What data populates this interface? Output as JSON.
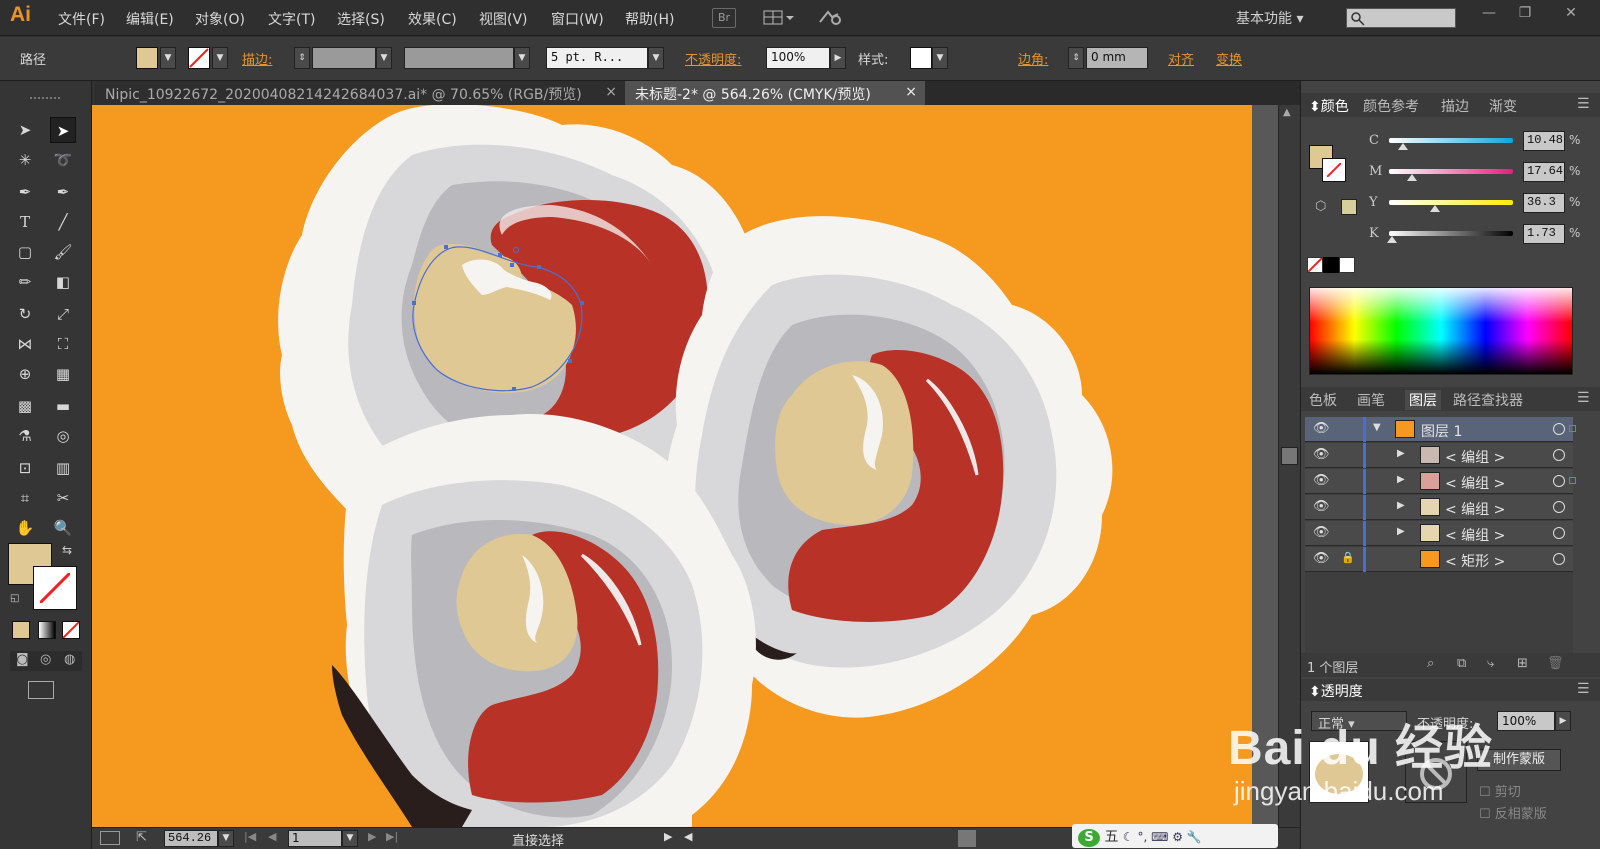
{
  "app": {
    "logo": "Ai",
    "workspace": "基本功能"
  },
  "menu": [
    "文件(F)",
    "编辑(E)",
    "对象(O)",
    "文字(T)",
    "选择(S)",
    "效果(C)",
    "视图(V)",
    "窗口(W)",
    "帮助(H)"
  ],
  "menu_icons": {
    "bridge": "Br",
    "arrange": "arrange-icon",
    "sync": "sync-icon"
  },
  "control": {
    "path_label": "路径",
    "stroke_label": "描边",
    "brush_value": "5 pt. R...",
    "opacity_label": "不透明度",
    "opacity_value": "100%",
    "style_label": "样式",
    "corner_label": "边角",
    "corner_value": "0 mm",
    "align_label": "对齐",
    "transform_label": "变换",
    "fill_color": "#dfc893"
  },
  "tabs": [
    {
      "label": "Nipic_10922672_20200408214242684037.ai* @ 70.65% (RGB/预览)",
      "close": "×"
    },
    {
      "label": "未标题-2* @ 564.26% (CMYK/预览)",
      "close": "×"
    }
  ],
  "status": {
    "zoom": "564.26",
    "page": "1",
    "tool_label": "直接选择"
  },
  "color_panel": {
    "tabs": [
      "颜色",
      "颜色参考",
      "描边",
      "渐变"
    ],
    "channels": [
      {
        "label": "C",
        "value": "10.48",
        "pct": 10.48
      },
      {
        "label": "M",
        "value": "17.64",
        "pct": 17.64
      },
      {
        "label": "Y",
        "value": "36.3",
        "pct": 36.3
      },
      {
        "label": "K",
        "value": "1.73",
        "pct": 1.73
      }
    ],
    "unit": "%"
  },
  "layers_panel": {
    "tabs": [
      "色板",
      "画笔",
      "图层",
      "路径查找器"
    ],
    "rows": [
      {
        "name": "图层 1",
        "top": true
      },
      {
        "name": "< 编组 >"
      },
      {
        "name": "< 编组 >"
      },
      {
        "name": "< 编组 >"
      },
      {
        "name": "< 编组 >"
      },
      {
        "name": "< 矩形 >",
        "locked": true
      }
    ],
    "footer": "1 个图层"
  },
  "transparency_panel": {
    "title": "透明度",
    "blend": "正常",
    "opacity_label": "不透明度",
    "opacity_value": "100%",
    "mask_button": "制作蒙版",
    "clip_label": "剪切",
    "invert_label": "反相蒙版"
  },
  "watermark": {
    "brand": "Bai du 经验",
    "url": "jingyan.baidu.com"
  },
  "ime": {
    "text": "五"
  },
  "colors": {
    "orange": "#f5991f",
    "beige": "#dfc893",
    "red": "#b83228",
    "shell_white": "#f5f4f1",
    "shell_gray": "#d8d8da",
    "inner_gray": "#b9b9bd"
  }
}
